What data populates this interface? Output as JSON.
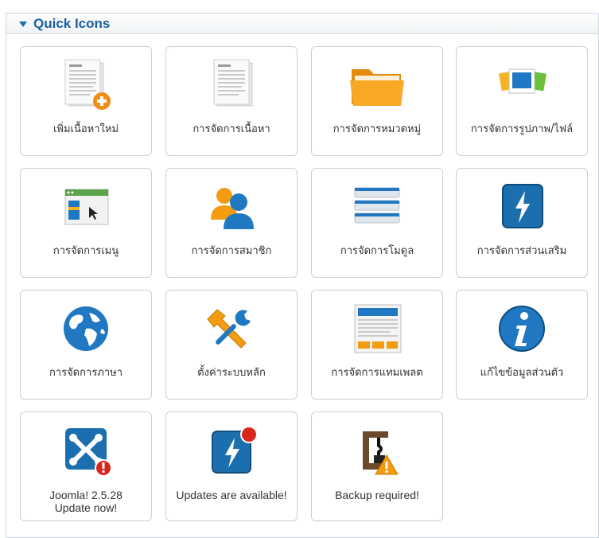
{
  "panel": {
    "title": "Quick Icons"
  },
  "colors": {
    "accent": "#1a5f9e",
    "folder": "#f7a21b",
    "lightning_blue": "#1c6fae",
    "alert_red": "#d9261c",
    "warning_orange": "#f39c12"
  },
  "tiles": [
    {
      "label": "เพิ่มเนื้อหาใหม่",
      "icon": "add-article-icon"
    },
    {
      "label": "การจัดการเนื้อหา",
      "icon": "article-icon"
    },
    {
      "label": "การจัดการหมวดหมู่",
      "icon": "folder-icon"
    },
    {
      "label": "การจัดการรูปภาพ/ไฟล์",
      "icon": "media-icon"
    },
    {
      "label": "การจัดการเมนู",
      "icon": "menu-icon"
    },
    {
      "label": "การจัดการสมาชิก",
      "icon": "users-icon"
    },
    {
      "label": "การจัดการโมดูล",
      "icon": "module-icon"
    },
    {
      "label": "การจัดการส่วนเสริม",
      "icon": "extension-icon"
    },
    {
      "label": "การจัดการภาษา",
      "icon": "globe-icon"
    },
    {
      "label": "ตั้งค่าระบบหลัก",
      "icon": "tools-icon"
    },
    {
      "label": "การจัดการแทมเพลต",
      "icon": "template-icon"
    },
    {
      "label": "แก้ไขข้อมูลส่วนตัว",
      "icon": "info-icon"
    },
    {
      "label_line1": "Joomla! 2.5.28",
      "label_line2": "Update now!",
      "icon": "joomla-icon"
    },
    {
      "label": "Updates are available!",
      "icon": "updates-icon",
      "badge": "!"
    },
    {
      "label": "Backup required!",
      "icon": "backup-icon"
    }
  ]
}
